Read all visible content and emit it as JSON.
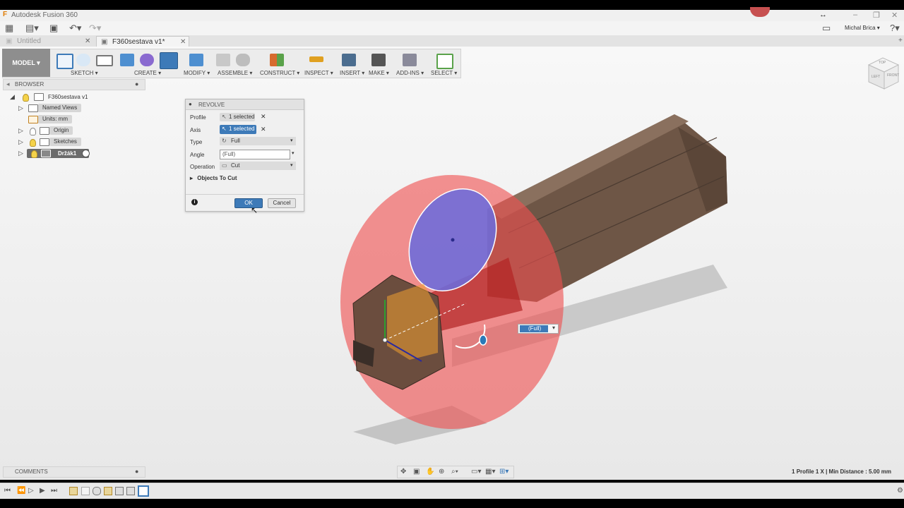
{
  "app": {
    "title": "Autodesk Fusion 360"
  },
  "user": {
    "name": "Michal Brica"
  },
  "tabs": [
    {
      "label": "Untitled"
    },
    {
      "label": "F360sestava v1*"
    }
  ],
  "workspace": {
    "label": "MODEL"
  },
  "toolbar_groups": [
    {
      "label": "SKETCH"
    },
    {
      "label": "CREATE"
    },
    {
      "label": "MODIFY"
    },
    {
      "label": "ASSEMBLE"
    },
    {
      "label": "CONSTRUCT"
    },
    {
      "label": "INSPECT"
    },
    {
      "label": "INSERT"
    },
    {
      "label": "MAKE"
    },
    {
      "label": "ADD-INS"
    },
    {
      "label": "SELECT"
    }
  ],
  "browser": {
    "title": "BROWSER",
    "root": "F360sestava v1",
    "items": [
      {
        "label": "Named Views"
      },
      {
        "label": "Units: mm"
      },
      {
        "label": "Origin"
      },
      {
        "label": "Sketches"
      },
      {
        "label": "Držák1"
      }
    ]
  },
  "revolve": {
    "title": "REVOLVE",
    "profile_label": "Profile",
    "profile_value": "1 selected",
    "axis_label": "Axis",
    "axis_value": "1 selected",
    "type_label": "Type",
    "type_value": "Full",
    "angle_label": "Angle",
    "angle_value": "(Full)",
    "operation_label": "Operation",
    "operation_value": "Cut",
    "objects_to_cut": "Objects To Cut",
    "ok_label": "OK",
    "cancel_label": "Cancel"
  },
  "viewport": {
    "angle_input": "(Full)"
  },
  "viewcube": {
    "top": "TOP",
    "left": "LEFT",
    "front": "FRONT"
  },
  "comments": {
    "title": "COMMENTS"
  },
  "status": {
    "text": "1 Profile 1 X | Min Distance : 5.00 mm"
  },
  "colors": {
    "accent": "#3d7ab8",
    "cut_red": "#e8464a",
    "profile_blue": "#6a6ad8",
    "part_brown": "#6e5646"
  }
}
